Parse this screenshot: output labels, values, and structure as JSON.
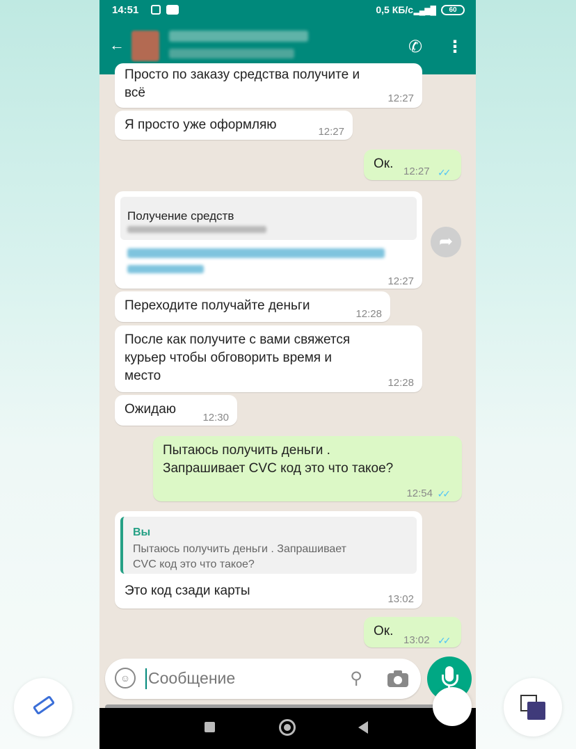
{
  "status_bar": {
    "time": "14:51",
    "network_speed": "0,5 КБ/с",
    "battery": "60"
  },
  "messages": [
    {
      "id": "m1",
      "direction": "in",
      "text_lines": [
        "Просто по заказу средства получите и",
        "всё"
      ],
      "time": "12:27"
    },
    {
      "id": "m2",
      "direction": "in",
      "text": "Я просто уже оформляю",
      "time": "12:27"
    },
    {
      "id": "m3",
      "direction": "out",
      "text": "Ок.",
      "time": "12:27",
      "read": true
    },
    {
      "id": "m4",
      "direction": "in",
      "link_title": "Получение средств",
      "time": "12:27"
    },
    {
      "id": "m5",
      "direction": "in",
      "text": "Переходите получайте деньги",
      "time": "12:28"
    },
    {
      "id": "m6",
      "direction": "in",
      "text_lines": [
        "После как получите с вами свяжется",
        "курьер чтобы обговорить время и",
        "место"
      ],
      "time": "12:28"
    },
    {
      "id": "m7",
      "direction": "in",
      "text": "Ожидаю",
      "time": "12:30"
    },
    {
      "id": "m8",
      "direction": "out",
      "text_lines": [
        "Пытаюсь получить деньги .",
        "Запрашивает CVC код это что такое?"
      ],
      "time": "12:54",
      "read": true
    },
    {
      "id": "m9",
      "direction": "in",
      "quote_author": "Вы",
      "quote_lines": [
        "Пытаюсь получить деньги . Запрашивает",
        "CVC код это что такое?"
      ],
      "text": "Это код сзади карты",
      "time": "13:02"
    },
    {
      "id": "m10",
      "direction": "out",
      "text": "Ок.",
      "time": "13:02",
      "read": true
    }
  ],
  "input": {
    "placeholder": "Сообщение"
  },
  "icons": {
    "call": "add-call-icon",
    "menu": "more-vert-icon",
    "forward": "forward-icon",
    "emoji": "emoji-icon",
    "attach": "paperclip-icon",
    "camera": "camera-icon",
    "mic": "mic-icon"
  },
  "colors": {
    "header": "#00897b",
    "outgoing_bubble": "#dcf8c6",
    "incoming_bubble": "#ffffff",
    "chat_bg": "#ece5dd",
    "read_ticks": "#4fc3f7",
    "mic_button": "#00a884"
  }
}
